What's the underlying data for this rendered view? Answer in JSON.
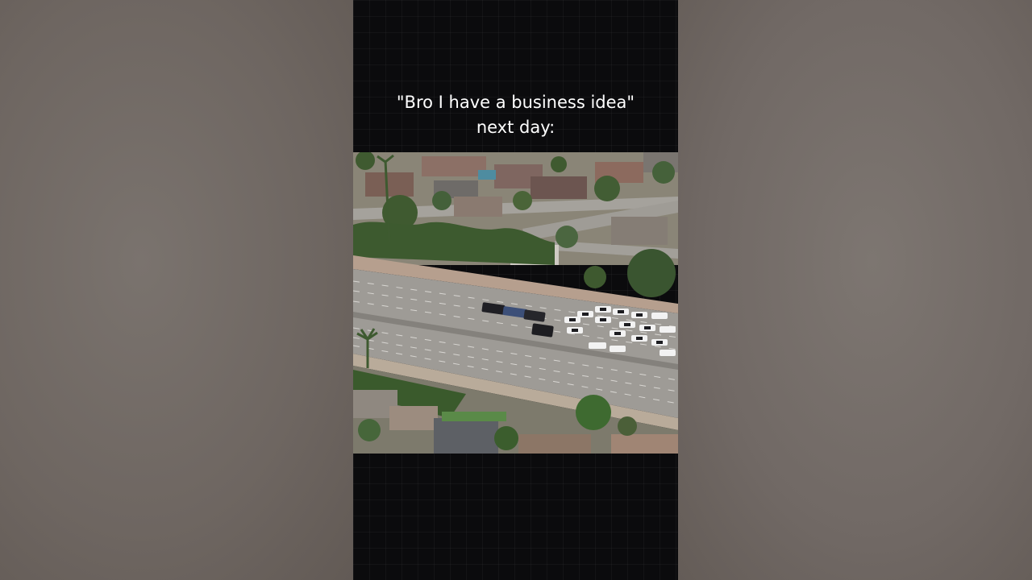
{
  "caption": {
    "line1": "\"Bro I have a business idea\"",
    "line2": "next day:"
  },
  "scene": {
    "subject": "aerial-freeway-police-scene"
  },
  "colors": {
    "background": "#6f6761",
    "player_bg": "#0b0b0d",
    "caption_text": "#ffffff",
    "road": "#9d9a95",
    "grass": "#5f7a45",
    "trees": "#3e5a2e"
  }
}
